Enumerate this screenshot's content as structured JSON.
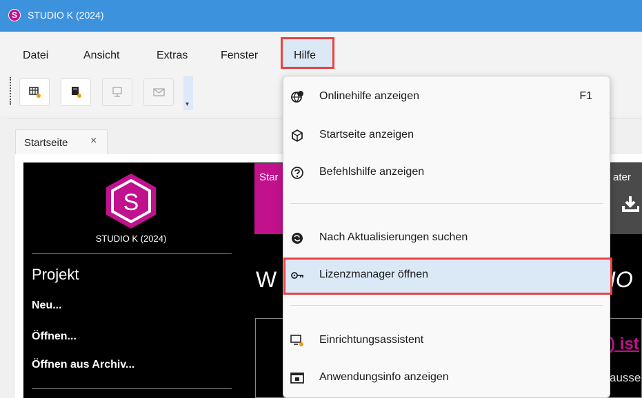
{
  "window": {
    "title": "STUDIO K (2024)",
    "app_icon_letter": "S"
  },
  "menubar": {
    "items": [
      "Datei",
      "Ansicht",
      "Extras",
      "Fenster",
      "Hilfe"
    ]
  },
  "toolbar": {
    "overflow_glyph": "▾"
  },
  "tabs": [
    {
      "label": "Startseite",
      "close": "×"
    }
  ],
  "startpage": {
    "logo_letter": "S",
    "logo_text": "STUDIO K (2024)",
    "section_title": "Projekt",
    "links": [
      "Neu...",
      "Öffnen...",
      "Öffnen aus Archiv..."
    ],
    "banner_fragment": "Star",
    "right_fragment": "ater",
    "heading_fragment_left": "W",
    "heading_fragment_right": "IO",
    "pink_fragment": ") ist",
    "text_fragment": "ausse"
  },
  "help_menu": {
    "items": [
      {
        "label": "Onlinehilfe anzeigen",
        "shortcut": "F1",
        "icon": "globe-help-icon"
      },
      {
        "label": "Startseite anzeigen",
        "shortcut": "",
        "icon": "cube-icon"
      },
      {
        "label": "Befehlshilfe anzeigen",
        "shortcut": "",
        "icon": "question-circle-icon"
      },
      {
        "label": "Nach Aktualisierungen suchen",
        "shortcut": "",
        "icon": "globe-update-icon"
      },
      {
        "label": "Lizenzmanager öffnen",
        "shortcut": "",
        "icon": "license-key-icon"
      },
      {
        "label": "Einrichtungsassistent",
        "shortcut": "",
        "icon": "setup-wizard-icon"
      },
      {
        "label": "Anwendungsinfo anzeigen",
        "shortcut": "",
        "icon": "info-window-icon"
      }
    ]
  },
  "colors": {
    "accent_magenta": "#c1118c",
    "titlebar_blue": "#3d92de",
    "highlight_red": "#e8433f",
    "hover_blue": "#dbe9f7"
  }
}
